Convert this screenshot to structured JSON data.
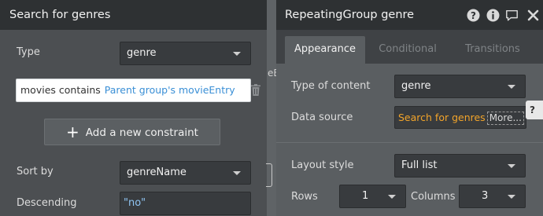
{
  "left_panel": {
    "title": "Search for genres",
    "type_label": "Type",
    "type_value": "genre",
    "constraint": {
      "field": "movies contains",
      "value": "Parent group's movieEntry"
    },
    "add_constraint_label": "Add a new constraint",
    "sort_by_label": "Sort by",
    "sort_by_value": "genreName",
    "descending_label": "Descending",
    "descending_value": "\"no\""
  },
  "background": {
    "partial_text": "eE"
  },
  "right_panel": {
    "title": "RepeatingGroup genre",
    "header_icons": [
      "help-icon",
      "info-icon",
      "comment-icon",
      "close-icon"
    ],
    "tabs": [
      {
        "label": "Appearance",
        "active": true
      },
      {
        "label": "Conditional",
        "active": false
      },
      {
        "label": "Transitions",
        "active": false
      }
    ],
    "type_of_content_label": "Type of content",
    "type_of_content_value": "genre",
    "data_source_label": "Data source",
    "data_source_value": "Search for genres",
    "data_source_more": "More...",
    "help_tab_label": "?",
    "layout_style_label": "Layout style",
    "layout_style_value": "Full list",
    "rows_label": "Rows",
    "rows_value": "1",
    "columns_label": "Columns",
    "columns_value": "3"
  },
  "colors": {
    "header_bg": "#2e3133",
    "panel_bg": "#4c4f52",
    "link_blue": "#3a8fd6",
    "dynamic_orange": "#f2a42a"
  }
}
